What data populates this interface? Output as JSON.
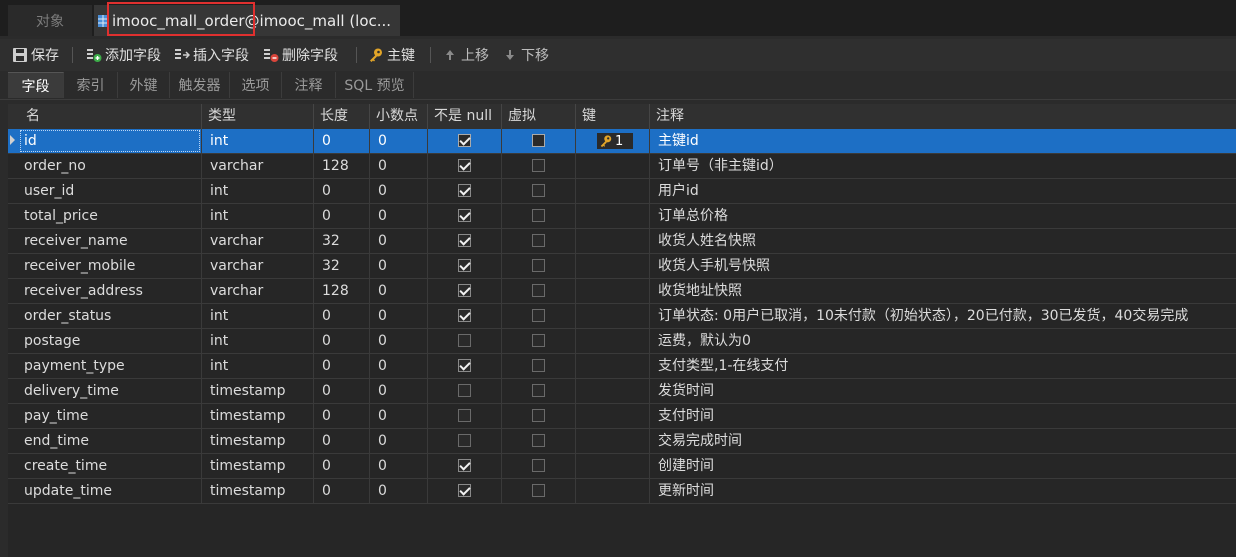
{
  "tabs": {
    "objects_label": "对象",
    "active_table": "imooc_mall_order",
    "active_suffix": " @imooc_mall (loc..."
  },
  "toolbar": {
    "save": "保存",
    "add_field": "添加字段",
    "insert_field": "插入字段",
    "delete_field": "删除字段",
    "primary_key": "主键",
    "move_up": "上移",
    "move_down": "下移"
  },
  "subtabs": [
    "字段",
    "索引",
    "外键",
    "触发器",
    "选项",
    "注释",
    "SQL 预览"
  ],
  "columns": [
    "名",
    "类型",
    "长度",
    "小数点",
    "不是 null",
    "虚拟",
    "键",
    "注释"
  ],
  "primary_key_index": "1",
  "rows": [
    {
      "name": "id",
      "type": "int",
      "length": "0",
      "decimals": "0",
      "not_null": true,
      "virtual": false,
      "key": true,
      "comment": "主键id"
    },
    {
      "name": "order_no",
      "type": "varchar",
      "length": "128",
      "decimals": "0",
      "not_null": true,
      "virtual": false,
      "key": false,
      "comment": "订单号（非主键id）"
    },
    {
      "name": "user_id",
      "type": "int",
      "length": "0",
      "decimals": "0",
      "not_null": true,
      "virtual": false,
      "key": false,
      "comment": "用户id"
    },
    {
      "name": "total_price",
      "type": "int",
      "length": "0",
      "decimals": "0",
      "not_null": true,
      "virtual": false,
      "key": false,
      "comment": "订单总价格"
    },
    {
      "name": "receiver_name",
      "type": "varchar",
      "length": "32",
      "decimals": "0",
      "not_null": true,
      "virtual": false,
      "key": false,
      "comment": "收货人姓名快照"
    },
    {
      "name": "receiver_mobile",
      "type": "varchar",
      "length": "32",
      "decimals": "0",
      "not_null": true,
      "virtual": false,
      "key": false,
      "comment": "收货人手机号快照"
    },
    {
      "name": "receiver_address",
      "type": "varchar",
      "length": "128",
      "decimals": "0",
      "not_null": true,
      "virtual": false,
      "key": false,
      "comment": "收货地址快照"
    },
    {
      "name": "order_status",
      "type": "int",
      "length": "0",
      "decimals": "0",
      "not_null": true,
      "virtual": false,
      "key": false,
      "comment": "订单状态: 0用户已取消，10未付款（初始状态），20已付款，30已发货，40交易完成"
    },
    {
      "name": "postage",
      "type": "int",
      "length": "0",
      "decimals": "0",
      "not_null": false,
      "virtual": false,
      "key": false,
      "comment": "运费，默认为0"
    },
    {
      "name": "payment_type",
      "type": "int",
      "length": "0",
      "decimals": "0",
      "not_null": true,
      "virtual": false,
      "key": false,
      "comment": "支付类型,1-在线支付"
    },
    {
      "name": "delivery_time",
      "type": "timestamp",
      "length": "0",
      "decimals": "0",
      "not_null": false,
      "virtual": false,
      "key": false,
      "comment": "发货时间"
    },
    {
      "name": "pay_time",
      "type": "timestamp",
      "length": "0",
      "decimals": "0",
      "not_null": false,
      "virtual": false,
      "key": false,
      "comment": "支付时间"
    },
    {
      "name": "end_time",
      "type": "timestamp",
      "length": "0",
      "decimals": "0",
      "not_null": false,
      "virtual": false,
      "key": false,
      "comment": "交易完成时间"
    },
    {
      "name": "create_time",
      "type": "timestamp",
      "length": "0",
      "decimals": "0",
      "not_null": true,
      "virtual": false,
      "key": false,
      "comment": "创建时间"
    },
    {
      "name": "update_time",
      "type": "timestamp",
      "length": "0",
      "decimals": "0",
      "not_null": true,
      "virtual": false,
      "key": false,
      "comment": "更新时间"
    }
  ],
  "selected_row": 0,
  "colors": {
    "selection": "#1d6fc5",
    "highlight_box": "#e0302f",
    "key_icon": "#e2a528"
  }
}
